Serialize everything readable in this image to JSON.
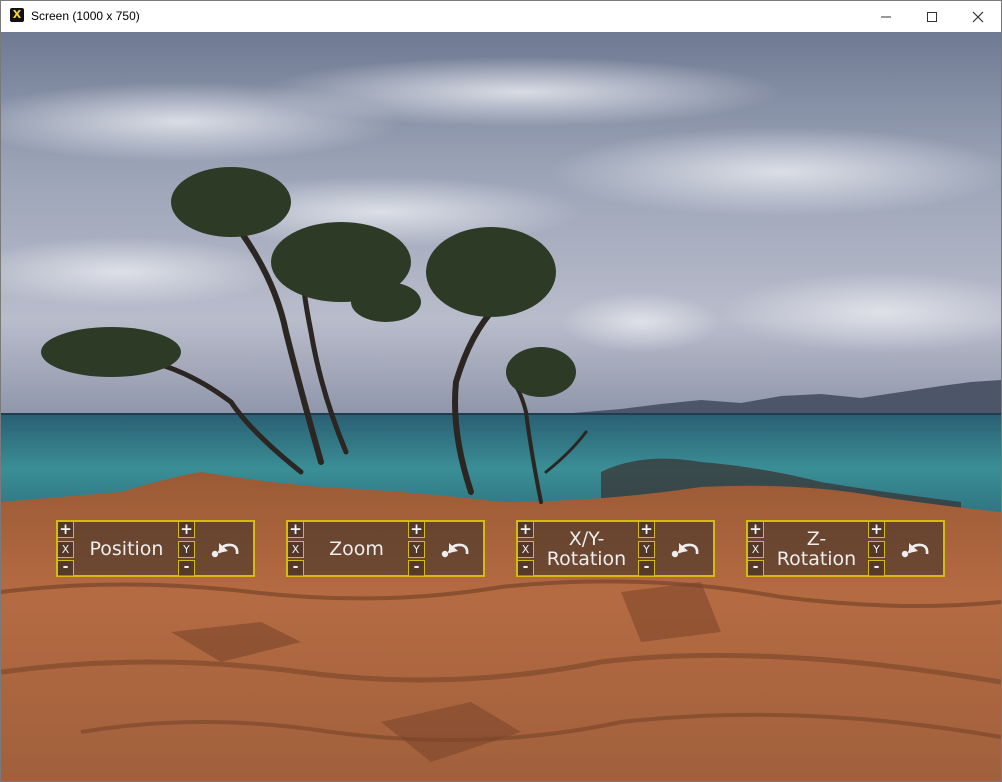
{
  "window": {
    "title": "Screen (1000 x 750)",
    "icon": "x-app-icon",
    "controls": [
      "minimize-icon",
      "maximize-icon",
      "close-icon"
    ]
  },
  "panels": [
    {
      "label": "Position",
      "plus": "+",
      "minus": "-",
      "axis_left": "X",
      "axis_right": "Y",
      "reset_icon": "undo-icon"
    },
    {
      "label": "Zoom",
      "plus": "+",
      "minus": "-",
      "axis_left": "X",
      "axis_right": "Y",
      "reset_icon": "undo-icon"
    },
    {
      "label": "X/Y-\nRotation",
      "plus": "+",
      "minus": "-",
      "axis_left": "X",
      "axis_right": "Y",
      "reset_icon": "undo-icon"
    },
    {
      "label": "Z-\nRotation",
      "plus": "+",
      "minus": "-",
      "axis_left": "X",
      "axis_right": "Y",
      "reset_icon": "undo-icon"
    }
  ],
  "colors": {
    "panel_border": "#d4bb12",
    "sky": "#8b93a8",
    "sea": "#2f7f8a",
    "rock": "#b86a3e"
  }
}
